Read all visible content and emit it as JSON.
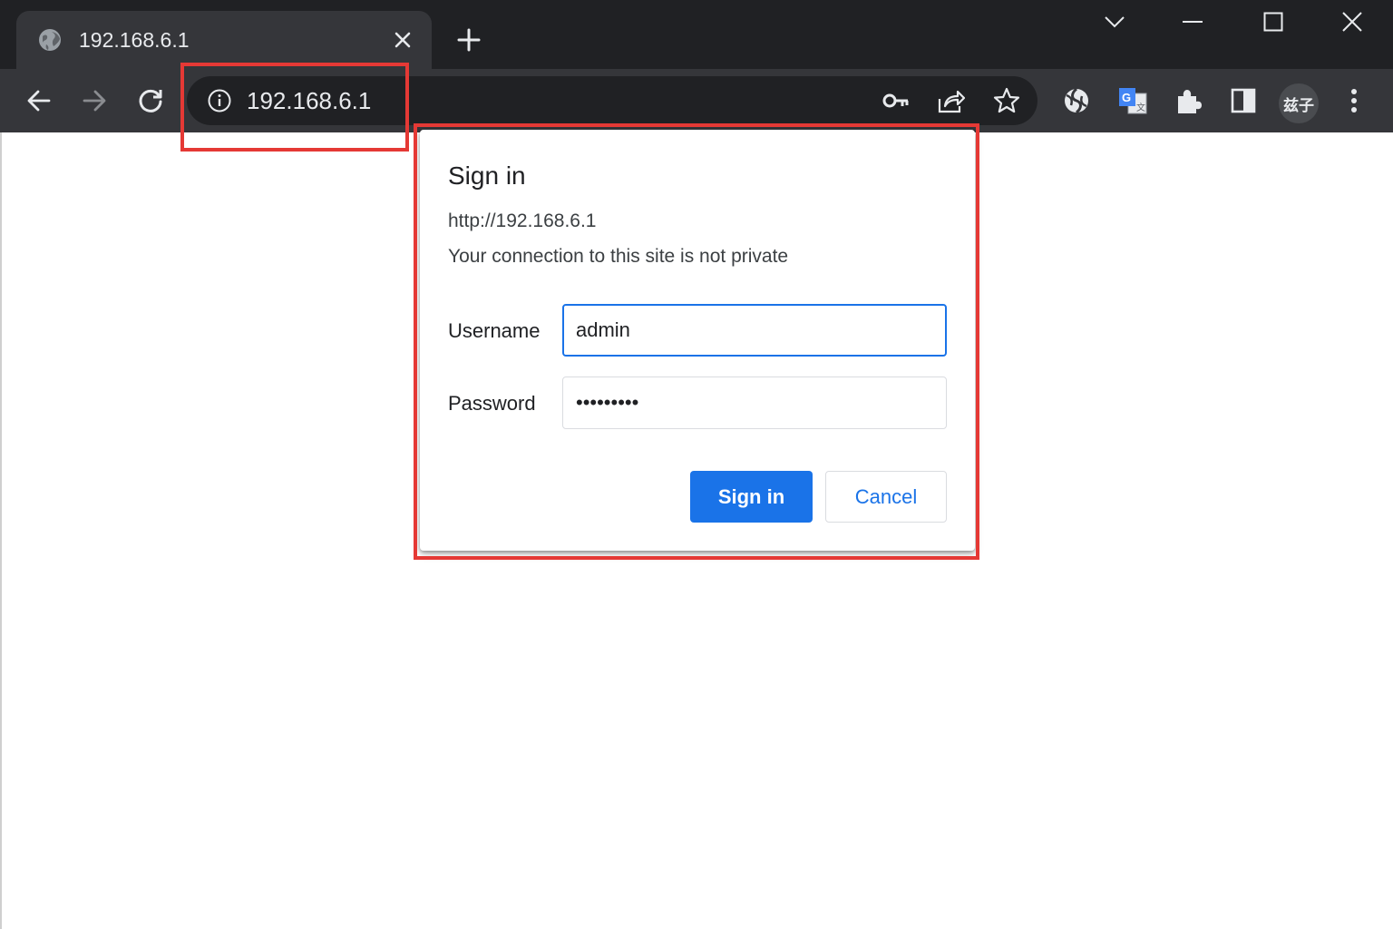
{
  "browser": {
    "tab": {
      "title": "192.168.6.1",
      "favicon": "globe-icon",
      "close_icon": "close-icon"
    },
    "new_tab_icon": "plus-icon",
    "window_controls": [
      "tab-search-icon",
      "minimize-icon",
      "maximize-icon",
      "window-close-icon"
    ],
    "toolbar": {
      "nav_icons": [
        "back-arrow-icon",
        "forward-arrow-icon",
        "reload-icon"
      ],
      "omnibox": {
        "info_icon": "info-icon",
        "url": "192.168.6.1",
        "action_icons": [
          "key-icon",
          "share-icon",
          "star-icon"
        ]
      },
      "extension_icons": [
        "extension-swirl-icon",
        "translate-icon",
        "puzzle-icon",
        "side-panel-icon"
      ],
      "profile_label": "兹子",
      "menu_icon": "kebab-menu-icon"
    }
  },
  "dialog": {
    "title": "Sign in",
    "origin": "http://192.168.6.1",
    "warning": "Your connection to this site is not private",
    "username_label": "Username",
    "username_value": "admin",
    "password_label": "Password",
    "password_value": "•••••••••",
    "signin_label": "Sign in",
    "cancel_label": "Cancel"
  },
  "colors": {
    "tabstrip_bg": "#202124",
    "toolbar_bg": "#35363a",
    "accent_blue": "#1a73e8",
    "highlight_red": "#e53935"
  }
}
